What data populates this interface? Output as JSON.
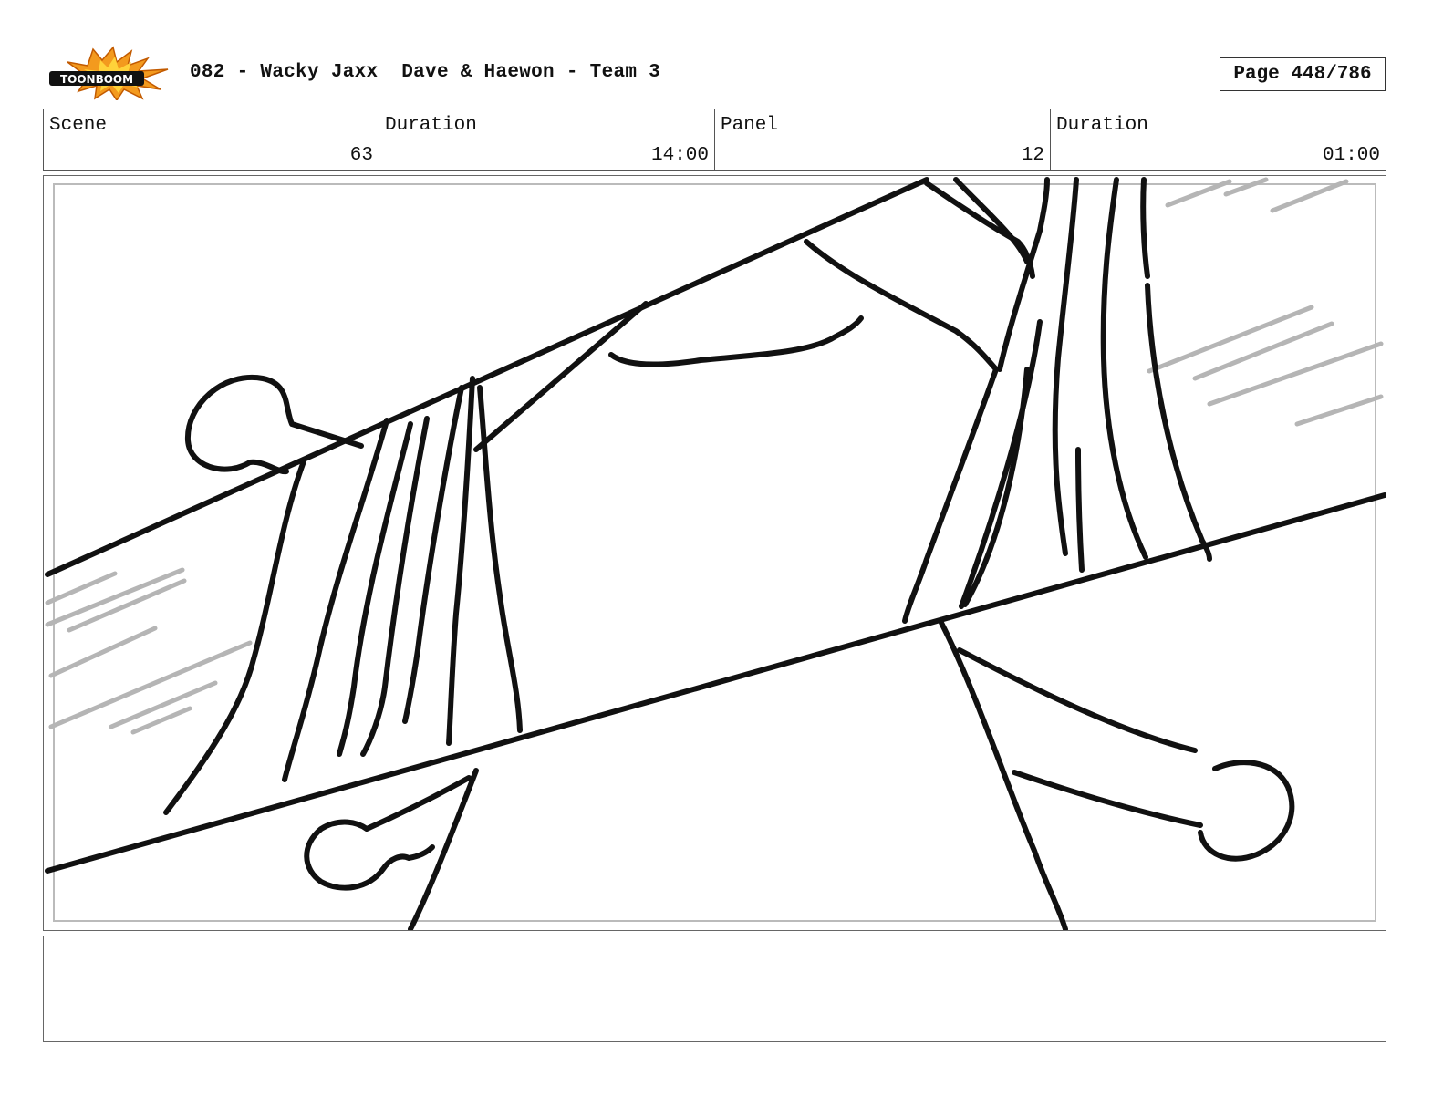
{
  "header": {
    "logo_text": "TOONBOOM",
    "title": "082 - Wacky Jaxx  Dave & Haewon - Team 3",
    "page": "Page 448/786"
  },
  "info": {
    "scene_label": "Scene",
    "scene_value": "63",
    "scene_duration_label": "Duration",
    "scene_duration_value": "14:00",
    "panel_label": "Panel",
    "panel_value": "12",
    "panel_duration_label": "Duration",
    "panel_duration_value": "01:00"
  },
  "notes": {
    "text": ""
  }
}
